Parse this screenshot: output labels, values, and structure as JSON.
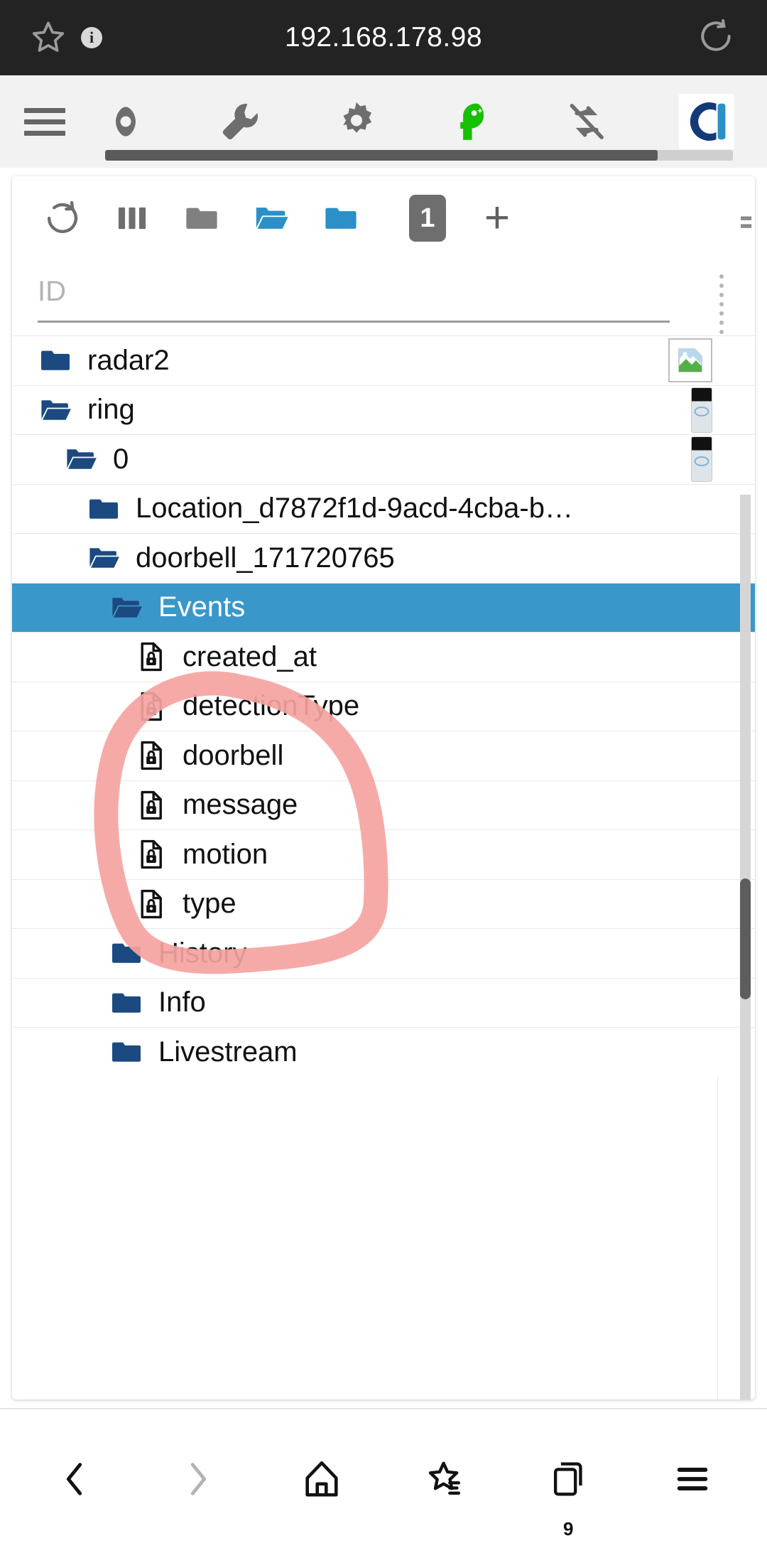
{
  "browser": {
    "url": "192.168.178.98",
    "star_icon": "star-outline-icon",
    "info_icon": "info-icon",
    "info_label": "i",
    "reload_icon": "reload-icon"
  },
  "extension_toolbar": {
    "menu_icon": "hamburger-menu-icon",
    "items": [
      {
        "name": "eye-icon",
        "color": "#6e6e6e"
      },
      {
        "name": "wrench-icon",
        "color": "#6e6e6e"
      },
      {
        "name": "gear-icon",
        "color": "#6e6e6e"
      },
      {
        "name": "head-plus-icon",
        "color": "#17c000"
      },
      {
        "name": "sync-disabled-icon",
        "color": "#6e6e6e"
      },
      {
        "name": "ci-logo-icon",
        "color": "#123a78"
      }
    ],
    "progress_percent": 88
  },
  "card_toolbar": {
    "buttons": [
      {
        "name": "refresh-icon",
        "label": "",
        "color": "#6e6e6e"
      },
      {
        "name": "columns-icon",
        "label": "",
        "color": "#6e6e6e"
      },
      {
        "name": "folder-closed-gray-icon",
        "label": "",
        "color": "#808080"
      },
      {
        "name": "folder-open-blue-icon",
        "label": "",
        "color": "#2b90c6"
      },
      {
        "name": "folder-closed-blue-icon",
        "label": "",
        "color": "#2b90c6"
      },
      {
        "name": "depth-badge",
        "label": "1",
        "color": "#6e6e6e"
      },
      {
        "name": "add-icon",
        "label": "+",
        "color": "#5f5f5f"
      }
    ],
    "depth_value": "1",
    "add_label": "+"
  },
  "search": {
    "placeholder": "ID",
    "value": ""
  },
  "tree": {
    "selected_index": 5,
    "rows": [
      {
        "label": "radar2",
        "icon": "folder-closed-icon",
        "depth": 0,
        "thumb": "broken-image",
        "selected": false,
        "annotated": false
      },
      {
        "label": "ring",
        "icon": "folder-open-icon",
        "depth": 0,
        "thumb": "ring-doorbell",
        "selected": false,
        "annotated": false
      },
      {
        "label": "0",
        "icon": "folder-open-icon",
        "depth": 1,
        "thumb": "ring-doorbell",
        "selected": false,
        "annotated": false
      },
      {
        "label": "Location_d7872f1d-9acd-4cba-b…",
        "icon": "folder-closed-icon",
        "depth": 2,
        "thumb": "",
        "selected": false,
        "annotated": false
      },
      {
        "label": "doorbell_171720765",
        "icon": "folder-open-icon",
        "depth": 2,
        "thumb": "",
        "selected": false,
        "annotated": false
      },
      {
        "label": "Events",
        "icon": "folder-open-icon",
        "depth": 3,
        "thumb": "",
        "selected": true,
        "annotated": false
      },
      {
        "label": "created_at",
        "icon": "file-lock-icon",
        "depth": 4,
        "thumb": "",
        "selected": false,
        "annotated": false
      },
      {
        "label": "detectionType",
        "icon": "file-lock-icon",
        "depth": 4,
        "thumb": "",
        "selected": false,
        "annotated": true
      },
      {
        "label": "doorbell",
        "icon": "file-lock-icon",
        "depth": 4,
        "thumb": "",
        "selected": false,
        "annotated": true
      },
      {
        "label": "message",
        "icon": "file-lock-icon",
        "depth": 4,
        "thumb": "",
        "selected": false,
        "annotated": true
      },
      {
        "label": "motion",
        "icon": "file-lock-icon",
        "depth": 4,
        "thumb": "",
        "selected": false,
        "annotated": false
      },
      {
        "label": "type",
        "icon": "file-lock-icon",
        "depth": 4,
        "thumb": "",
        "selected": false,
        "annotated": false
      },
      {
        "label": "History",
        "icon": "folder-closed-icon",
        "depth": 3,
        "thumb": "",
        "selected": false,
        "annotated": false
      },
      {
        "label": "Info",
        "icon": "folder-closed-icon",
        "depth": 3,
        "thumb": "",
        "selected": false,
        "annotated": false
      },
      {
        "label": "Livestream",
        "icon": "folder-closed-icon",
        "depth": 3,
        "thumb": "",
        "selected": false,
        "annotated": false
      }
    ]
  },
  "annotation": {
    "shape": "hand-drawn-ellipse",
    "color": "#f5a3a0",
    "covers": [
      "detectionType",
      "doorbell",
      "message"
    ]
  },
  "bottom_nav": {
    "items": [
      {
        "name": "back-icon",
        "enabled": true
      },
      {
        "name": "forward-icon",
        "enabled": false
      },
      {
        "name": "home-icon",
        "enabled": true
      },
      {
        "name": "bookmarks-icon",
        "enabled": true
      },
      {
        "name": "tabs-icon",
        "enabled": true
      },
      {
        "name": "menu-icon",
        "enabled": true
      }
    ],
    "tab_count": "9"
  },
  "colors": {
    "selection_blue": "#3a97ca",
    "folder_navy": "#1b4a80",
    "toolbar_blue": "#2b90c6",
    "annotation_pink": "#f5a3a0",
    "urlbar_black": "#232323",
    "green_icon": "#17c000"
  }
}
